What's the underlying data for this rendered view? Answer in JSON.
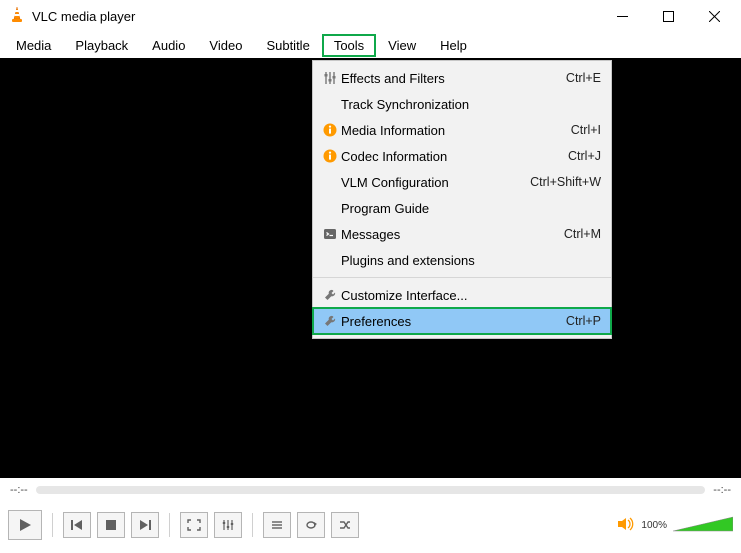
{
  "window": {
    "title": "VLC media player"
  },
  "menubar": {
    "items": [
      {
        "label": "Media"
      },
      {
        "label": "Playback"
      },
      {
        "label": "Audio"
      },
      {
        "label": "Video"
      },
      {
        "label": "Subtitle"
      },
      {
        "label": "Tools",
        "highlighted": true
      },
      {
        "label": "View"
      },
      {
        "label": "Help"
      }
    ]
  },
  "tools_menu": {
    "items": [
      {
        "icon": "sliders-icon",
        "label": "Effects and Filters",
        "shortcut": "Ctrl+E"
      },
      {
        "icon": "",
        "label": "Track Synchronization",
        "shortcut": ""
      },
      {
        "icon": "info-icon",
        "label": "Media Information",
        "shortcut": "Ctrl+I"
      },
      {
        "icon": "info-icon",
        "label": "Codec Information",
        "shortcut": "Ctrl+J"
      },
      {
        "icon": "",
        "label": "VLM Configuration",
        "shortcut": "Ctrl+Shift+W"
      },
      {
        "icon": "",
        "label": "Program Guide",
        "shortcut": ""
      },
      {
        "icon": "terminal-icon",
        "label": "Messages",
        "shortcut": "Ctrl+M"
      },
      {
        "icon": "",
        "label": "Plugins and extensions",
        "shortcut": ""
      }
    ],
    "items2": [
      {
        "icon": "wrench-icon",
        "label": "Customize Interface...",
        "shortcut": ""
      },
      {
        "icon": "wrench-icon",
        "label": "Preferences",
        "shortcut": "Ctrl+P",
        "highlighted": true
      }
    ]
  },
  "timeline": {
    "elapsed": "--:--",
    "total": "--:--"
  },
  "volume": {
    "percent_label": "100%"
  }
}
